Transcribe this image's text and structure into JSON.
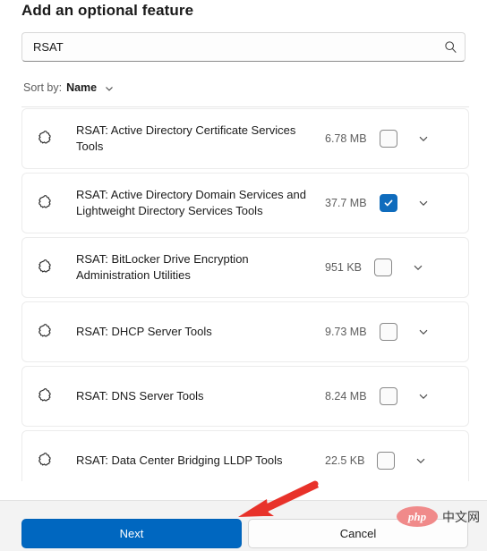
{
  "dialog": {
    "title": "Add an optional feature"
  },
  "search": {
    "value": "RSAT",
    "placeholder": "",
    "icon": "search-icon"
  },
  "sort": {
    "label": "Sort by:",
    "value": "Name",
    "chevron_icon": "chevron-down-icon"
  },
  "list": {
    "row_icon": "puzzle-piece-icon",
    "expand_icon": "chevron-down-icon",
    "items": [
      {
        "name": "RSAT: Active Directory Certificate Services Tools",
        "size": "6.78 MB",
        "checked": false
      },
      {
        "name": "RSAT: Active Directory Domain Services and Lightweight Directory Services Tools",
        "size": "37.7 MB",
        "checked": true
      },
      {
        "name": "RSAT: BitLocker Drive Encryption Administration Utilities",
        "size": "951 KB",
        "checked": false
      },
      {
        "name": "RSAT: DHCP Server Tools",
        "size": "9.73 MB",
        "checked": false
      },
      {
        "name": "RSAT: DNS Server Tools",
        "size": "8.24 MB",
        "checked": false
      },
      {
        "name": "RSAT: Data Center Bridging LLDP Tools",
        "size": "22.5 KB",
        "checked": false
      }
    ]
  },
  "footer": {
    "next_label": "Next",
    "cancel_label": "Cancel"
  },
  "annotation": {
    "arrow_color": "#e8322a"
  },
  "watermark": {
    "badge_text": "php",
    "text": "中文网",
    "badge_color": "#f08a8a"
  },
  "colors": {
    "accent": "#0067c0",
    "checkbox_checked": "#0f6cbd",
    "footer_bg": "#f3f3f3"
  }
}
